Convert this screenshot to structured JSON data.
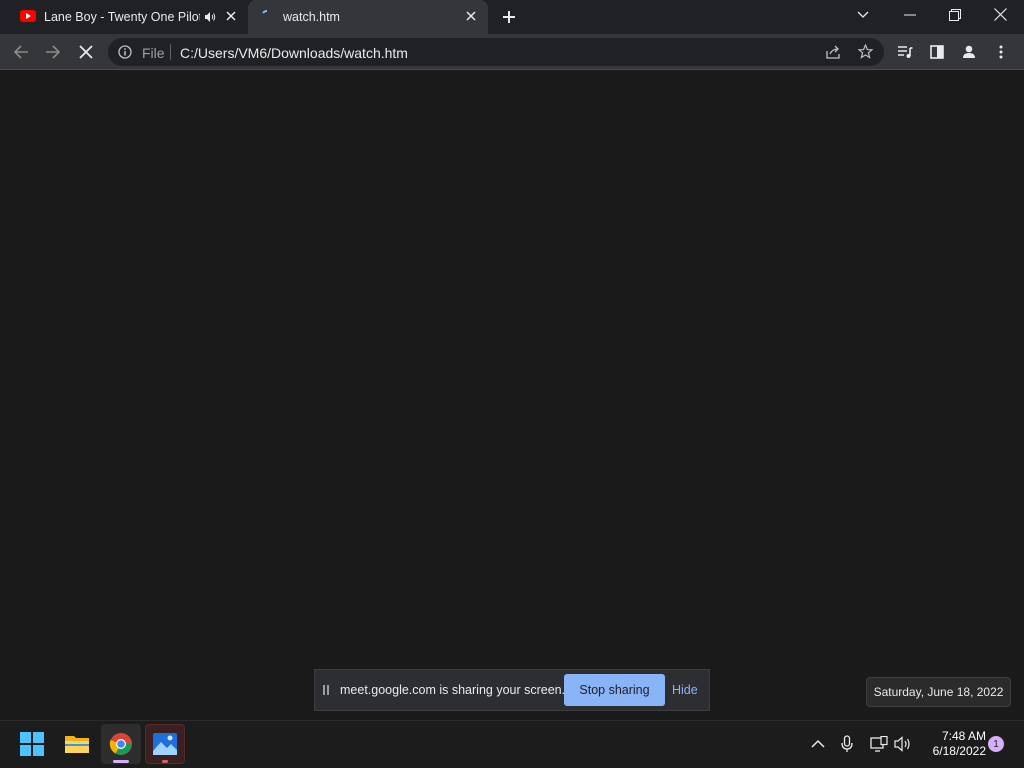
{
  "tabs": [
    {
      "title": "Lane Boy - Twenty One Pilots",
      "favicon": "youtube-icon",
      "audio": "speaker-icon",
      "active": false
    },
    {
      "title": "watch.htm",
      "favicon": "loading-spinner-icon",
      "active": true
    }
  ],
  "toolbar": {
    "security_label": "File",
    "url": "C:/Users/VM6/Downloads/watch.htm"
  },
  "sharing": {
    "message": "meet.google.com is sharing your screen.",
    "stop_label": "Stop sharing",
    "hide_label": "Hide"
  },
  "taskbar": {
    "date_tooltip": "Saturday, June 18, 2022",
    "time": "7:48 AM",
    "date": "6/18/2022",
    "notifications": "1"
  },
  "colors": {
    "accent": "#8ab4f8",
    "youtube": "#ff0000",
    "badge": "#d7aefb"
  }
}
